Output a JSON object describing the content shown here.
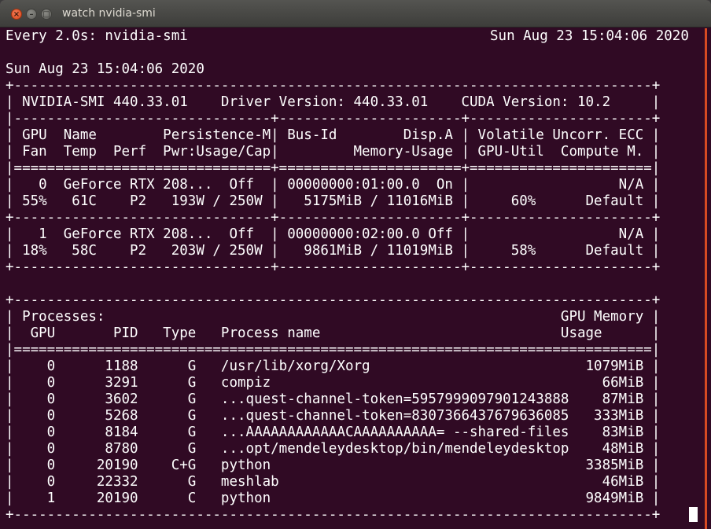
{
  "window": {
    "title": "watch nvidia-smi"
  },
  "header": {
    "left": "Every 2.0s: nvidia-smi",
    "right": "Sun Aug 23 15:04:06 2020"
  },
  "terminal": {
    "lines": [
      "Sun Aug 23 15:04:06 2020",
      "+-----------------------------------------------------------------------------+",
      "| NVIDIA-SMI 440.33.01    Driver Version: 440.33.01    CUDA Version: 10.2     |",
      "|-------------------------------+----------------------+----------------------+",
      "| GPU  Name        Persistence-M| Bus-Id        Disp.A | Volatile Uncorr. ECC |",
      "| Fan  Temp  Perf  Pwr:Usage/Cap|         Memory-Usage | GPU-Util  Compute M. |",
      "|===============================+======================+======================|",
      "|   0  GeForce RTX 208...  Off  | 00000000:01:00.0  On |                  N/A |",
      "| 55%   61C    P2   193W / 250W |   5175MiB / 11016MiB |     60%      Default |",
      "+-------------------------------+----------------------+----------------------+",
      "|   1  GeForce RTX 208...  Off  | 00000000:02:00.0 Off |                  N/A |",
      "| 18%   58C    P2   203W / 250W |   9861MiB / 11019MiB |     58%      Default |",
      "+-------------------------------+----------------------+----------------------+",
      "",
      "+-----------------------------------------------------------------------------+",
      "| Processes:                                                       GPU Memory |",
      "|  GPU       PID   Type   Process name                             Usage      |",
      "|=============================================================================|",
      "|    0      1188      G   /usr/lib/xorg/Xorg                          1079MiB |",
      "|    0      3291      G   compiz                                        66MiB |",
      "|    0      3602      G   ...quest-channel-token=5957999097901243888    87MiB |",
      "|    0      5268      G   ...quest-channel-token=8307366437679636085   333MiB |",
      "|    0      8184      G   ...AAAAAAAAAAAACAAAAAAAAAA= --shared-files    83MiB |",
      "|    0      8780      G   ...opt/mendeleydesktop/bin/mendeleydesktop    48MiB |",
      "|    0     20190    C+G   python                                      3385MiB |",
      "|    0     22332      G   meshlab                                       46MiB |",
      "|    1     20190      C   python                                      9849MiB |",
      "+-----------------------------------------------------------------------------+"
    ]
  }
}
